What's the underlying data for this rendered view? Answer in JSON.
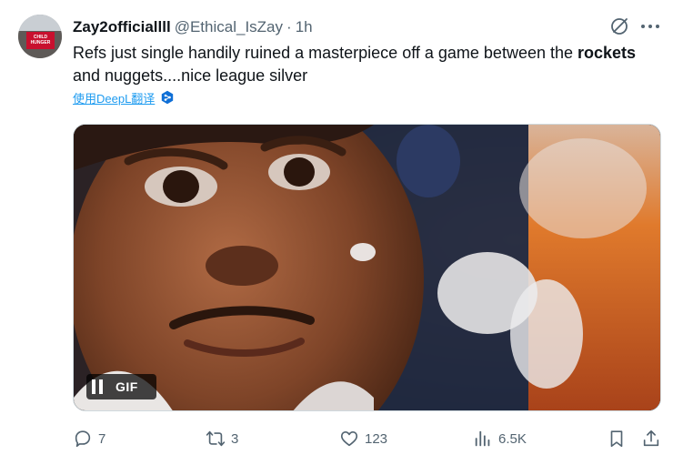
{
  "tweet": {
    "display_name": "Zay2officiallll",
    "handle": "@Ethical_IsZay",
    "separator": "·",
    "time": "1h",
    "text_segments": [
      "Refs just single handily ruined a masterpiece off a game between the ",
      "rockets",
      " and nuggets....nice league silver"
    ],
    "translate_label": "使用DeepL翻译",
    "avatar_banner_text": "CHILD HUNGER"
  },
  "media": {
    "type": "gif",
    "badge_label": "GIF",
    "pause_icon": "pause-icon"
  },
  "actions": {
    "replies": "7",
    "reposts": "3",
    "likes": "123",
    "views": "6.5K"
  },
  "icons": {
    "grok": "grok-icon",
    "more": "more-icon",
    "reply": "reply-icon",
    "repost": "repost-icon",
    "like": "heart-icon",
    "views": "views-icon",
    "bookmark": "bookmark-icon",
    "share": "share-icon",
    "deepl": "deepl-icon"
  },
  "colors": {
    "text_primary": "#0f1419",
    "text_secondary": "#536471",
    "link_blue": "#1d9bf0"
  }
}
